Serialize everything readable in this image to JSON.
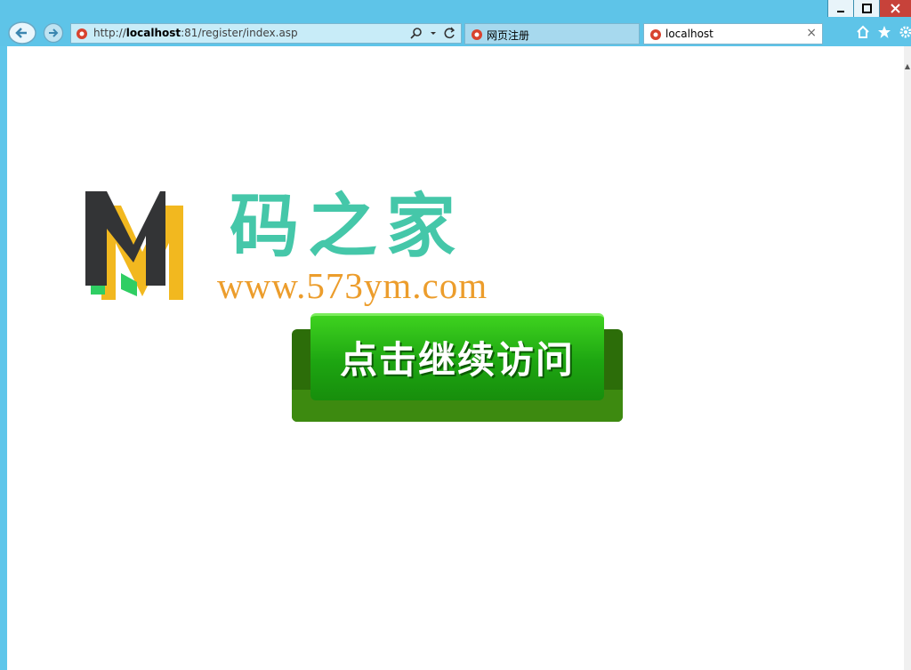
{
  "browser": {
    "address": {
      "url_prefix": "http://",
      "url_host": "localhost",
      "url_rest": ":81/register/index.asp"
    },
    "tabs": [
      {
        "label": "网页注册",
        "active": false
      },
      {
        "label": "localhost",
        "active": true
      }
    ],
    "close_tab_glyph": "×"
  },
  "page": {
    "brand_name": "码之家",
    "brand_url": "www.573ym.com",
    "cta_label": "点击继续访问"
  },
  "colors": {
    "brand_teal": "#45c7a9",
    "brand_orange": "#ec9d2c",
    "cta_green": "#1da511",
    "chrome_blue": "#5ec4e8"
  },
  "icons": [
    "back-icon",
    "forward-icon",
    "site-favicon",
    "search-icon",
    "dropdown-icon",
    "refresh-icon",
    "close-icon",
    "home-icon",
    "favorites-star-icon",
    "settings-gear-icon",
    "minimize-icon",
    "maximize-icon",
    "window-close-icon"
  ]
}
